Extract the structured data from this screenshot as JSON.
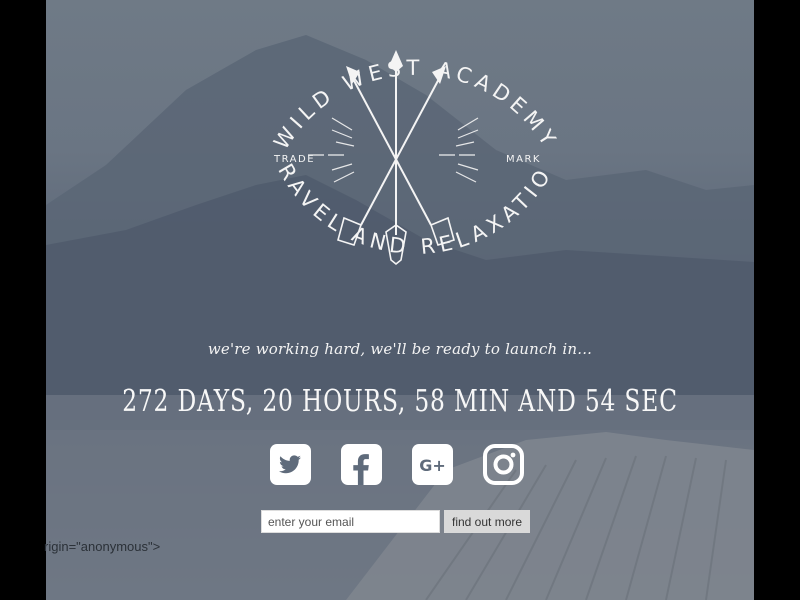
{
  "brand": {
    "arc_top": "WILD WEST ACADEMY",
    "arc_bottom": "TRAVEL AND RELAXATION",
    "left_mark": "TRADE",
    "right_mark": "MARK"
  },
  "tagline": "we're working hard, we'll be ready to launch in...",
  "countdown": "272 DAYS, 20 HOURS, 58 MIN AND 54 SEC",
  "socials": [
    {
      "name": "twitter",
      "icon": "twitter-icon"
    },
    {
      "name": "facebook",
      "icon": "facebook-icon"
    },
    {
      "name": "google-plus",
      "icon": "google-plus-icon",
      "label": "G+"
    },
    {
      "name": "instagram",
      "icon": "instagram-icon"
    }
  ],
  "signup": {
    "email_placeholder": "enter your email",
    "button_label": "find out more"
  },
  "stray_text": "rigin=\"anonymous\">",
  "colors": {
    "logo_white": "#f4f4f4",
    "overlay": "#5f6b7b"
  }
}
